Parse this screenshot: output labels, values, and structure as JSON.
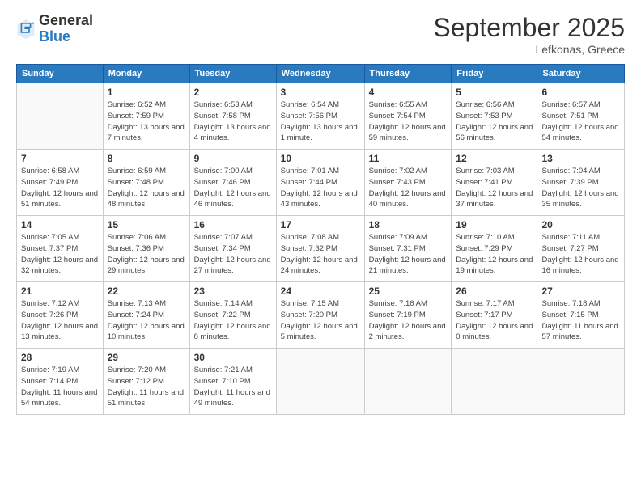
{
  "logo": {
    "general": "General",
    "blue": "Blue"
  },
  "header": {
    "month": "September 2025",
    "location": "Lefkonas, Greece"
  },
  "days": [
    "Sunday",
    "Monday",
    "Tuesday",
    "Wednesday",
    "Thursday",
    "Friday",
    "Saturday"
  ],
  "weeks": [
    [
      {
        "day": "",
        "sunrise": "",
        "sunset": "",
        "daylight": ""
      },
      {
        "day": "1",
        "sunrise": "Sunrise: 6:52 AM",
        "sunset": "Sunset: 7:59 PM",
        "daylight": "Daylight: 13 hours and 7 minutes."
      },
      {
        "day": "2",
        "sunrise": "Sunrise: 6:53 AM",
        "sunset": "Sunset: 7:58 PM",
        "daylight": "Daylight: 13 hours and 4 minutes."
      },
      {
        "day": "3",
        "sunrise": "Sunrise: 6:54 AM",
        "sunset": "Sunset: 7:56 PM",
        "daylight": "Daylight: 13 hours and 1 minute."
      },
      {
        "day": "4",
        "sunrise": "Sunrise: 6:55 AM",
        "sunset": "Sunset: 7:54 PM",
        "daylight": "Daylight: 12 hours and 59 minutes."
      },
      {
        "day": "5",
        "sunrise": "Sunrise: 6:56 AM",
        "sunset": "Sunset: 7:53 PM",
        "daylight": "Daylight: 12 hours and 56 minutes."
      },
      {
        "day": "6",
        "sunrise": "Sunrise: 6:57 AM",
        "sunset": "Sunset: 7:51 PM",
        "daylight": "Daylight: 12 hours and 54 minutes."
      }
    ],
    [
      {
        "day": "7",
        "sunrise": "Sunrise: 6:58 AM",
        "sunset": "Sunset: 7:49 PM",
        "daylight": "Daylight: 12 hours and 51 minutes."
      },
      {
        "day": "8",
        "sunrise": "Sunrise: 6:59 AM",
        "sunset": "Sunset: 7:48 PM",
        "daylight": "Daylight: 12 hours and 48 minutes."
      },
      {
        "day": "9",
        "sunrise": "Sunrise: 7:00 AM",
        "sunset": "Sunset: 7:46 PM",
        "daylight": "Daylight: 12 hours and 46 minutes."
      },
      {
        "day": "10",
        "sunrise": "Sunrise: 7:01 AM",
        "sunset": "Sunset: 7:44 PM",
        "daylight": "Daylight: 12 hours and 43 minutes."
      },
      {
        "day": "11",
        "sunrise": "Sunrise: 7:02 AM",
        "sunset": "Sunset: 7:43 PM",
        "daylight": "Daylight: 12 hours and 40 minutes."
      },
      {
        "day": "12",
        "sunrise": "Sunrise: 7:03 AM",
        "sunset": "Sunset: 7:41 PM",
        "daylight": "Daylight: 12 hours and 37 minutes."
      },
      {
        "day": "13",
        "sunrise": "Sunrise: 7:04 AM",
        "sunset": "Sunset: 7:39 PM",
        "daylight": "Daylight: 12 hours and 35 minutes."
      }
    ],
    [
      {
        "day": "14",
        "sunrise": "Sunrise: 7:05 AM",
        "sunset": "Sunset: 7:37 PM",
        "daylight": "Daylight: 12 hours and 32 minutes."
      },
      {
        "day": "15",
        "sunrise": "Sunrise: 7:06 AM",
        "sunset": "Sunset: 7:36 PM",
        "daylight": "Daylight: 12 hours and 29 minutes."
      },
      {
        "day": "16",
        "sunrise": "Sunrise: 7:07 AM",
        "sunset": "Sunset: 7:34 PM",
        "daylight": "Daylight: 12 hours and 27 minutes."
      },
      {
        "day": "17",
        "sunrise": "Sunrise: 7:08 AM",
        "sunset": "Sunset: 7:32 PM",
        "daylight": "Daylight: 12 hours and 24 minutes."
      },
      {
        "day": "18",
        "sunrise": "Sunrise: 7:09 AM",
        "sunset": "Sunset: 7:31 PM",
        "daylight": "Daylight: 12 hours and 21 minutes."
      },
      {
        "day": "19",
        "sunrise": "Sunrise: 7:10 AM",
        "sunset": "Sunset: 7:29 PM",
        "daylight": "Daylight: 12 hours and 19 minutes."
      },
      {
        "day": "20",
        "sunrise": "Sunrise: 7:11 AM",
        "sunset": "Sunset: 7:27 PM",
        "daylight": "Daylight: 12 hours and 16 minutes."
      }
    ],
    [
      {
        "day": "21",
        "sunrise": "Sunrise: 7:12 AM",
        "sunset": "Sunset: 7:26 PM",
        "daylight": "Daylight: 12 hours and 13 minutes."
      },
      {
        "day": "22",
        "sunrise": "Sunrise: 7:13 AM",
        "sunset": "Sunset: 7:24 PM",
        "daylight": "Daylight: 12 hours and 10 minutes."
      },
      {
        "day": "23",
        "sunrise": "Sunrise: 7:14 AM",
        "sunset": "Sunset: 7:22 PM",
        "daylight": "Daylight: 12 hours and 8 minutes."
      },
      {
        "day": "24",
        "sunrise": "Sunrise: 7:15 AM",
        "sunset": "Sunset: 7:20 PM",
        "daylight": "Daylight: 12 hours and 5 minutes."
      },
      {
        "day": "25",
        "sunrise": "Sunrise: 7:16 AM",
        "sunset": "Sunset: 7:19 PM",
        "daylight": "Daylight: 12 hours and 2 minutes."
      },
      {
        "day": "26",
        "sunrise": "Sunrise: 7:17 AM",
        "sunset": "Sunset: 7:17 PM",
        "daylight": "Daylight: 12 hours and 0 minutes."
      },
      {
        "day": "27",
        "sunrise": "Sunrise: 7:18 AM",
        "sunset": "Sunset: 7:15 PM",
        "daylight": "Daylight: 11 hours and 57 minutes."
      }
    ],
    [
      {
        "day": "28",
        "sunrise": "Sunrise: 7:19 AM",
        "sunset": "Sunset: 7:14 PM",
        "daylight": "Daylight: 11 hours and 54 minutes."
      },
      {
        "day": "29",
        "sunrise": "Sunrise: 7:20 AM",
        "sunset": "Sunset: 7:12 PM",
        "daylight": "Daylight: 11 hours and 51 minutes."
      },
      {
        "day": "30",
        "sunrise": "Sunrise: 7:21 AM",
        "sunset": "Sunset: 7:10 PM",
        "daylight": "Daylight: 11 hours and 49 minutes."
      },
      {
        "day": "",
        "sunrise": "",
        "sunset": "",
        "daylight": ""
      },
      {
        "day": "",
        "sunrise": "",
        "sunset": "",
        "daylight": ""
      },
      {
        "day": "",
        "sunrise": "",
        "sunset": "",
        "daylight": ""
      },
      {
        "day": "",
        "sunrise": "",
        "sunset": "",
        "daylight": ""
      }
    ]
  ]
}
